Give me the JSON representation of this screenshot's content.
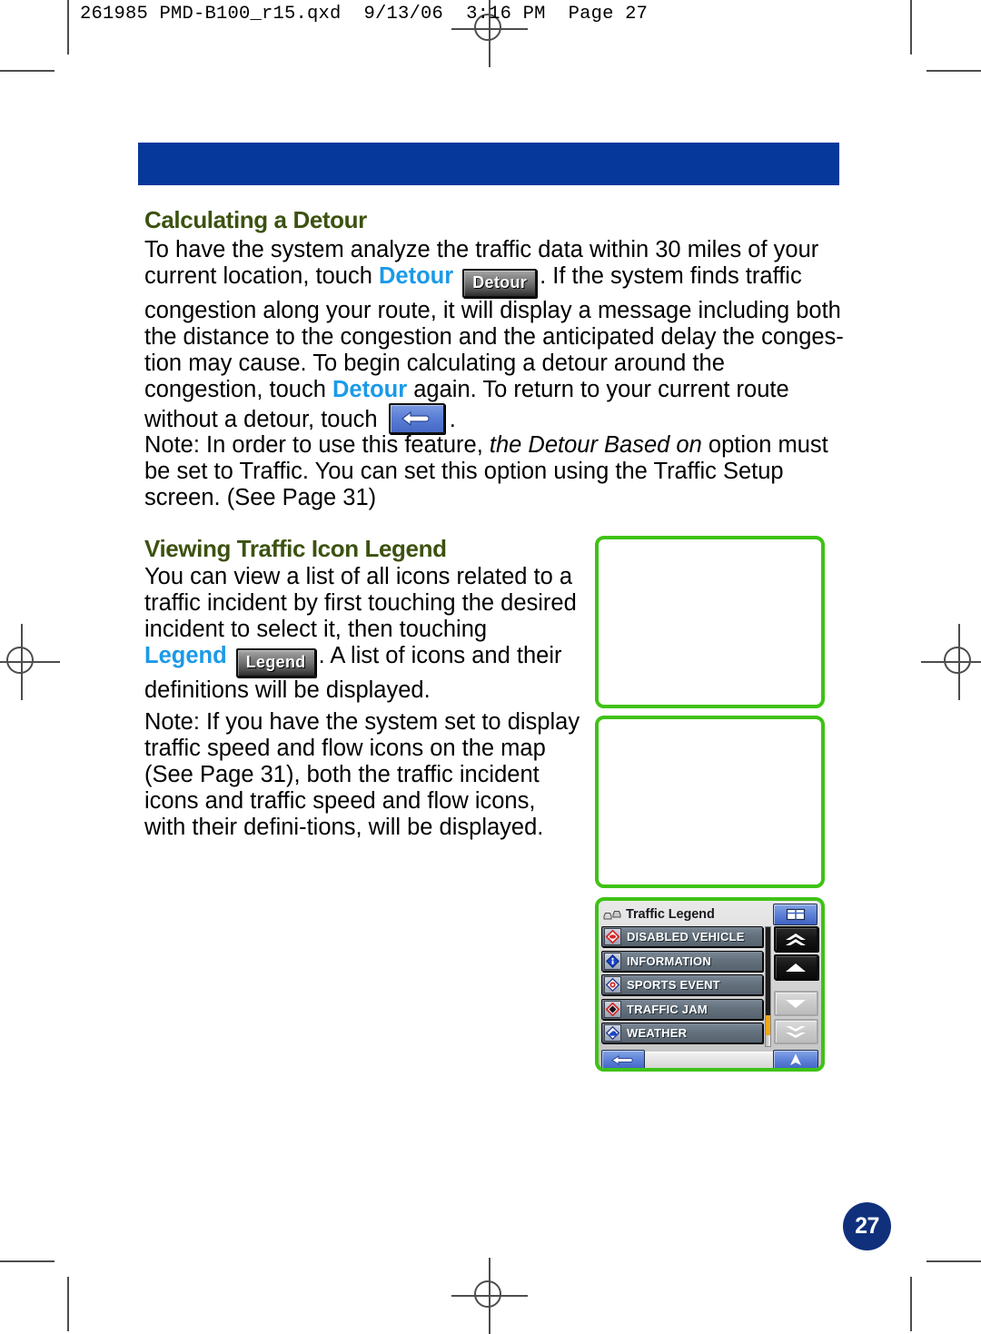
{
  "print_header": "261985 PMD-B100_r15.qxd  9/13/06  3:16 PM  Page 27",
  "page_number": "27",
  "colors": {
    "heading_green": "#3c5210",
    "highlight_blue": "#1b9ae8",
    "band_blue": "#06389c",
    "frame_green": "#3fc215",
    "page_badge_blue": "#10307c"
  },
  "sections": [
    {
      "id": "calculating-a-detour",
      "heading": "Calculating a Detour",
      "body_parts": [
        {
          "type": "text",
          "value": "To have the system analyze the traffic data within 30 miles of your current location, touch "
        },
        {
          "type": "highlight",
          "value": "Detour"
        },
        {
          "type": "button",
          "value": "Detour"
        },
        {
          "type": "text",
          "value": ". If the system finds traffic congestion along your route, it will display a message including both the distance to the congestion and the anticipated delay the conges-tion may cause. To begin calculating a detour around the congestion, touch "
        },
        {
          "type": "highlight",
          "value": "Detour"
        },
        {
          "type": "text",
          "value": " again. To return to your current route without a detour, touch "
        },
        {
          "type": "icon-button",
          "value": "back-arrow-icon"
        },
        {
          "type": "text",
          "value": "."
        }
      ],
      "note": {
        "label": "Note:",
        "before_italic": " In order to use this feature, ",
        "italic": "the Detour Based on",
        "after_italic": " option must be set to Traffic. You can set this option using the Traffic Setup screen. (See Page 31)"
      }
    },
    {
      "id": "viewing-traffic-icon-legend",
      "heading": "Viewing Traffic Icon Legend",
      "body_parts": [
        {
          "type": "text",
          "value": "You can view a list of all icons related to a traffic incident by first touching the desired incident to select it, then touching "
        },
        {
          "type": "highlight",
          "value": "Legend"
        },
        {
          "type": "button",
          "value": "Legend"
        },
        {
          "type": "text",
          "value": ". A list of icons and their definitions will be displayed."
        }
      ],
      "note": {
        "label": "Note:",
        "before_italic": " If you have the system set to display traffic speed and flow icons on the map (See Page 31), both the traffic incident icons and traffic speed and flow icons, with their defini-tions, will be displayed.",
        "italic": "",
        "after_italic": ""
      }
    }
  ],
  "figures": [
    {
      "id": "figure-placeholder-1",
      "caption": ""
    },
    {
      "id": "figure-placeholder-2",
      "caption": ""
    }
  ],
  "device_screen": {
    "title": "Traffic Legend",
    "title_icon": "traffic-vehicles-icon",
    "view_button_icon": "split-screen-icon",
    "legend_items": [
      {
        "label": "DISABLED VEHICLE",
        "icon": "disabled-vehicle-icon"
      },
      {
        "label": "INFORMATION",
        "icon": "information-icon"
      },
      {
        "label": "SPORTS EVENT",
        "icon": "sports-event-icon"
      },
      {
        "label": "TRAFFIC JAM",
        "icon": "traffic-jam-icon"
      },
      {
        "label": "WEATHER",
        "icon": "weather-icon"
      }
    ],
    "scroll_buttons": [
      {
        "icon": "double-chevron-up-icon",
        "state": "enabled"
      },
      {
        "icon": "chevron-up-icon",
        "state": "enabled"
      },
      {
        "icon": "chevron-down-icon",
        "state": "disabled"
      },
      {
        "icon": "double-chevron-down-icon",
        "state": "disabled"
      }
    ],
    "footer": {
      "back_icon": "back-arrow-icon",
      "compass_icon": "north-compass-icon"
    }
  }
}
